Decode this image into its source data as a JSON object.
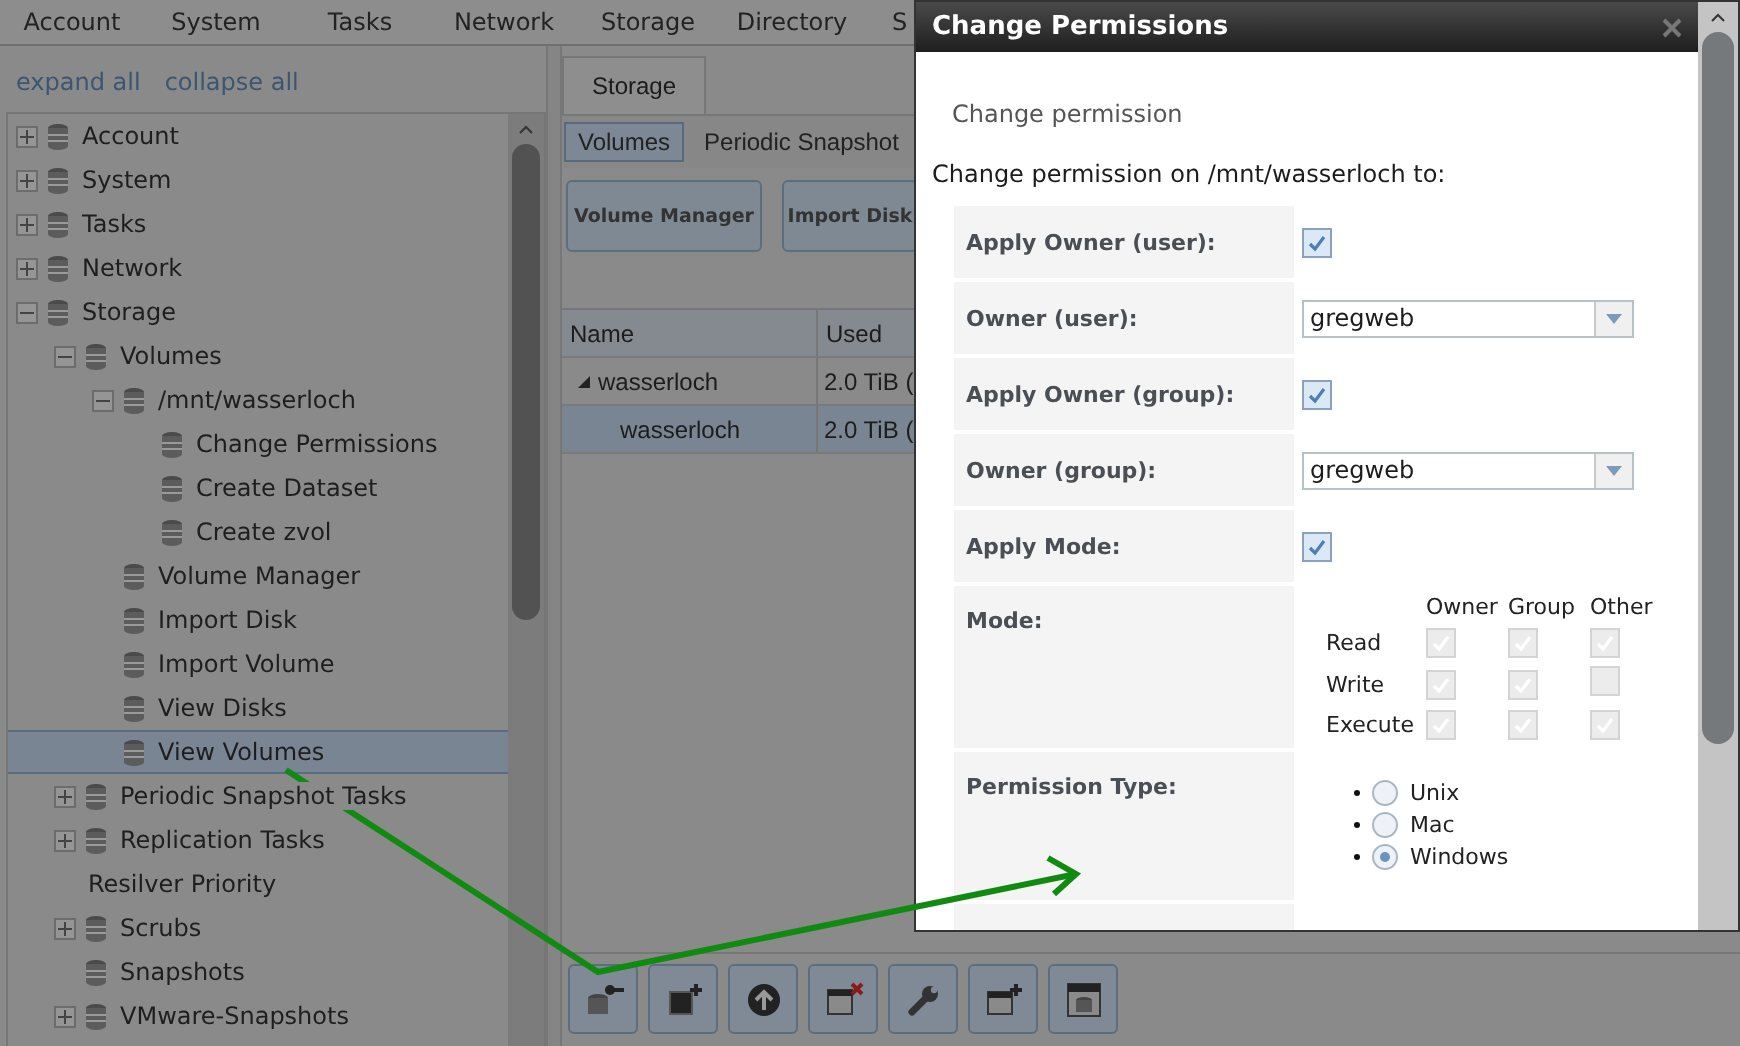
{
  "nav": {
    "items": [
      "Account",
      "System",
      "Tasks",
      "Network",
      "Storage",
      "Directory",
      "S"
    ]
  },
  "sidebar": {
    "links": [
      "expand all",
      "collapse all"
    ],
    "tree": [
      {
        "label": "Account",
        "kind": "icon",
        "expanded": false,
        "selected": false
      },
      {
        "label": "System",
        "kind": "icon",
        "expanded": false,
        "selected": false
      },
      {
        "label": "Tasks",
        "kind": "icon",
        "expanded": false,
        "selected": false
      },
      {
        "label": "Network",
        "kind": "icon",
        "expanded": false,
        "selected": false
      },
      {
        "label": "Storage",
        "kind": "icon",
        "expanded": true,
        "selected": false,
        "children": [
          {
            "label": "Volumes",
            "kind": "icon",
            "expanded": true,
            "selected": false,
            "children": [
              {
                "label": "/mnt/wasserloch",
                "kind": "icon",
                "expanded": true,
                "selected": false,
                "children": [
                  {
                    "label": "Change Permissions",
                    "kind": "icon",
                    "selected": false
                  },
                  {
                    "label": "Create Dataset",
                    "kind": "icon",
                    "selected": false
                  },
                  {
                    "label": "Create zvol",
                    "kind": "icon",
                    "selected": false
                  }
                ]
              },
              {
                "label": "Volume Manager",
                "kind": "icon",
                "selected": false
              },
              {
                "label": "Import Disk",
                "kind": "icon",
                "selected": false
              },
              {
                "label": "Import Volume",
                "kind": "icon",
                "selected": false
              },
              {
                "label": "View Disks",
                "kind": "icon",
                "selected": false
              },
              {
                "label": "View Volumes",
                "kind": "icon",
                "selected": true
              }
            ]
          },
          {
            "label": "Periodic Snapshot Tasks",
            "kind": "icon",
            "expanded": false,
            "selected": false
          },
          {
            "label": "Replication Tasks",
            "kind": "icon",
            "expanded": false,
            "selected": false
          },
          {
            "label": "Resilver Priority",
            "kind": "text",
            "selected": false
          },
          {
            "label": "Scrubs",
            "kind": "icon",
            "expanded": false,
            "selected": false
          },
          {
            "label": "Snapshots",
            "kind": "icon",
            "selected": false
          },
          {
            "label": "VMware-Snapshots",
            "kind": "icon",
            "expanded": false,
            "selected": false
          }
        ]
      }
    ]
  },
  "main": {
    "tab": "Storage",
    "subtabs": [
      {
        "label": "Volumes",
        "selected": true
      },
      {
        "label": "Periodic Snapshot",
        "selected": false
      }
    ],
    "buttons": [
      "Volume Manager",
      "Import Disk"
    ],
    "table": {
      "columns": [
        "Name",
        "Used"
      ],
      "rows": [
        {
          "name": "wasserloch",
          "used": "2.0 TiB (",
          "expanded": true,
          "selected": false,
          "children": [
            {
              "name": "wasserloch",
              "used": "2.0 TiB (",
              "selected": true
            }
          ]
        }
      ]
    },
    "toolbar": [
      {
        "kind": "key-database"
      },
      {
        "kind": "add-square"
      },
      {
        "kind": "upload"
      },
      {
        "kind": "delete-table"
      },
      {
        "kind": "wrench"
      },
      {
        "kind": "add-table"
      },
      {
        "kind": "database-table"
      }
    ]
  },
  "dialog": {
    "title": "Change Permissions",
    "heading": "Change permission",
    "intro": "Change permission on /mnt/wasserloch to:",
    "rows": [
      {
        "kind": "checkbox",
        "label": "Apply Owner (user):",
        "checked": true
      },
      {
        "kind": "select",
        "label": "Owner (user):",
        "value": "gregweb"
      },
      {
        "kind": "checkbox",
        "label": "Apply Owner (group):",
        "checked": true
      },
      {
        "kind": "select",
        "label": "Owner (group):",
        "value": "gregweb"
      },
      {
        "kind": "checkbox",
        "label": "Apply Mode:",
        "checked": true
      },
      {
        "kind": "mode",
        "label": "Mode:",
        "disabled": true,
        "columns": [
          "Owner",
          "Group",
          "Other"
        ],
        "rows": [
          {
            "label": "Read",
            "cells": [
              {
                "checked": true
              },
              {
                "checked": true
              },
              {
                "checked": true
              }
            ]
          },
          {
            "label": "Write",
            "cells": [
              {
                "checked": true
              },
              {
                "checked": true
              },
              {
                "checked": false
              }
            ]
          },
          {
            "label": "Execute",
            "cells": [
              {
                "checked": true
              },
              {
                "checked": true
              },
              {
                "checked": true
              }
            ]
          }
        ]
      },
      {
        "kind": "radio",
        "label": "Permission Type:",
        "options": [
          {
            "label": "Unix",
            "selected": false
          },
          {
            "label": "Mac",
            "selected": false
          },
          {
            "label": "Windows",
            "selected": true
          }
        ]
      },
      {
        "kind": "blank"
      }
    ]
  }
}
